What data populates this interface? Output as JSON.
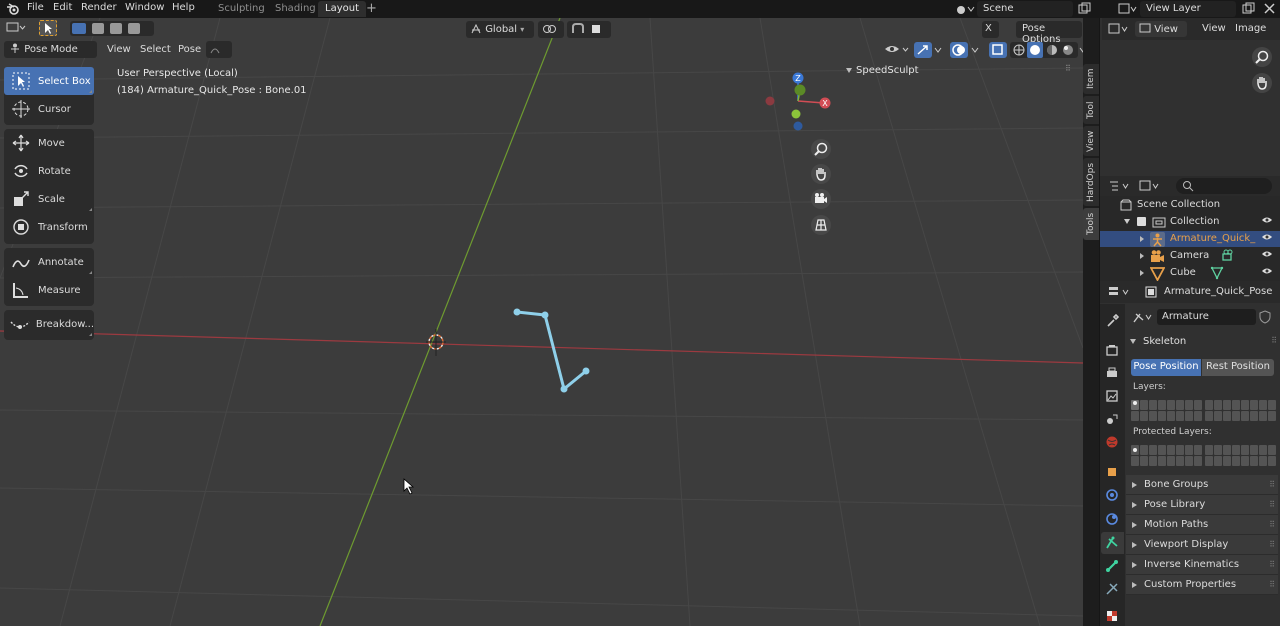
{
  "topbar": {
    "menus": [
      "File",
      "Edit",
      "Render",
      "Window",
      "Help"
    ],
    "workspaces": [
      "Sculpting",
      "Shading",
      "Layout"
    ],
    "active_workspace": "Layout",
    "add_tab": "+",
    "scene_name": "Scene",
    "view_layer": "View Layer"
  },
  "viewport_header": {
    "mode": "Pose Mode",
    "menus": [
      "View",
      "Select",
      "Pose"
    ],
    "orientation": "Global",
    "pose_options": "Pose Options",
    "close_x": "X"
  },
  "viewport": {
    "overlay_line1": "User Perspective (Local)",
    "overlay_line2": "(184) Armature_Quick_Pose : Bone.01",
    "speedsculpt_label": "SpeedSculpt",
    "gizmo": {
      "z": "Z",
      "x": "X"
    }
  },
  "toolbar": {
    "tools": [
      {
        "label": "Select Box",
        "icon": "select-box-icon",
        "active": true
      },
      {
        "label": "Cursor",
        "icon": "cursor-icon"
      },
      {
        "label": "Move",
        "icon": "move-icon"
      },
      {
        "label": "Rotate",
        "icon": "rotate-icon"
      },
      {
        "label": "Scale",
        "icon": "scale-icon"
      },
      {
        "label": "Transform",
        "icon": "transform-icon"
      },
      {
        "label": "Annotate",
        "icon": "annotate-icon"
      },
      {
        "label": "Measure",
        "icon": "measure-icon"
      },
      {
        "label": "Breakdow...",
        "icon": "breakdown-icon"
      }
    ]
  },
  "side_tabs": [
    "Item",
    "Tool",
    "View",
    "HardOps",
    "Tools"
  ],
  "image_editor": {
    "view": "View",
    "view2": "View",
    "image": "Image"
  },
  "outliner": {
    "scene_collection": "Scene Collection",
    "collection": "Collection",
    "items": [
      {
        "label": "Armature_Quick_Pose",
        "selected": true,
        "color": "#e8a04a"
      },
      {
        "label": "Camera",
        "selected": false,
        "color": "#e8a04a"
      },
      {
        "label": "Cube",
        "selected": false,
        "color": "#e8a04a"
      }
    ]
  },
  "properties": {
    "object_name": "Armature_Quick_Pose",
    "data_name": "Armature",
    "skeleton": "Skeleton",
    "pose_position": "Pose Position",
    "rest_position": "Rest Position",
    "layers": "Layers:",
    "protected_layers": "Protected Layers:",
    "panels": [
      "Bone Groups",
      "Pose Library",
      "Motion Paths",
      "Viewport Display",
      "Inverse Kinematics",
      "Custom Properties"
    ]
  },
  "colors": {
    "accent": "#4772b3",
    "bone": "#8fd0ea",
    "x_axis": "#d14d55",
    "y_axis": "#82b534",
    "z_axis": "#3a78d6"
  }
}
